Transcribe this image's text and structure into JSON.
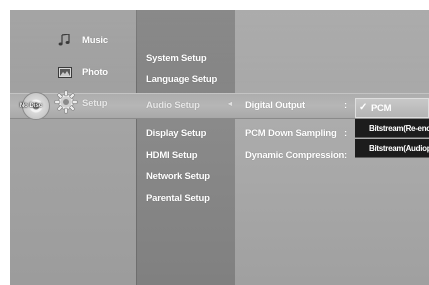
{
  "main_menu": {
    "items": [
      {
        "label": "Music",
        "icon": "music-icon"
      },
      {
        "label": "Photo",
        "icon": "photo-icon"
      },
      {
        "label": "Setup",
        "icon": "gear-icon"
      }
    ],
    "disc_status": "No Disc"
  },
  "setup_menu": {
    "items": [
      "System Setup",
      "Language Setup",
      "Audio Setup",
      "Display Setup",
      "HDMI Setup",
      "Network Setup",
      "Parental Setup"
    ],
    "selected": "Audio Setup",
    "arrow": "◂"
  },
  "audio_setup": {
    "rows": [
      {
        "label": "Digital Output",
        "sep": ":"
      },
      {
        "label": "PCM Down Sampling",
        "sep": ":"
      },
      {
        "label": "Dynamic Compression",
        "sep": ":"
      }
    ]
  },
  "digital_output_dropdown": {
    "options": [
      {
        "label": "PCM",
        "checked": true,
        "check_mark": "✓"
      },
      {
        "label": "Bitstream(Re-encode)",
        "checked": false
      },
      {
        "label": "Bitstream(Audiophile)",
        "checked": false
      }
    ]
  }
}
